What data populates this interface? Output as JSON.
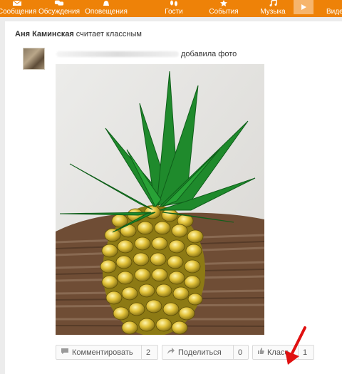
{
  "nav": {
    "items": [
      {
        "label": "Сообщения",
        "icon": "envelope-icon"
      },
      {
        "label": "Обсуждения",
        "icon": "chat-bubbles-icon"
      },
      {
        "label": "Оповещения",
        "icon": "bell-icon"
      },
      {
        "label": "Гости",
        "icon": "footprints-icon"
      },
      {
        "label": "События",
        "icon": "star-icon"
      },
      {
        "label": "Музыка",
        "icon": "music-note-icon"
      },
      {
        "label": "Виде",
        "icon": "video-play-icon"
      }
    ],
    "color": "#ee8208"
  },
  "feed": {
    "liker_name": "Аня Каминская",
    "liker_action": "считает классным",
    "author_action": "добавила фото",
    "photo_icon": "pineapple-candy-photo"
  },
  "actions": {
    "comment_label": "Комментировать",
    "comment_count": "2",
    "share_label": "Поделиться",
    "share_count": "0",
    "like_label": "Класс",
    "like_count": "1"
  },
  "annotation": {
    "arrow_color": "#e01010"
  }
}
